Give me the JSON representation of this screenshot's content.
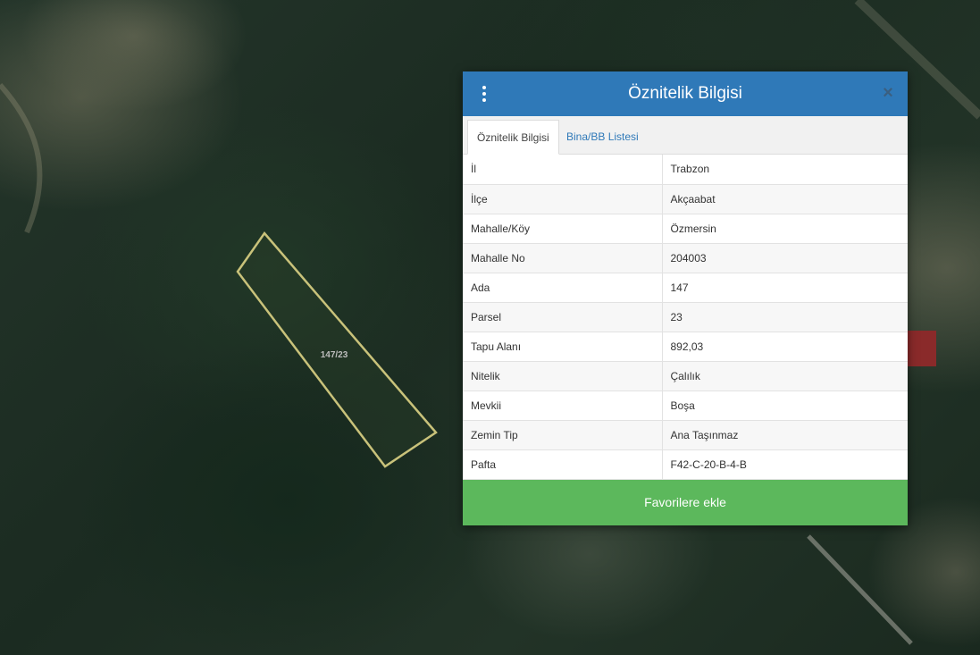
{
  "map": {
    "parcel_label": "147/23",
    "parcel_stroke": "#c9c27a"
  },
  "panel": {
    "title": "Öznitelik Bilgisi",
    "tabs": [
      {
        "label": "Öznitelik Bilgisi",
        "active": true
      },
      {
        "label": "Bina/BB Listesi",
        "active": false
      }
    ],
    "rows": [
      {
        "key": "İl",
        "value": "Trabzon"
      },
      {
        "key": "İlçe",
        "value": "Akçaabat"
      },
      {
        "key": "Mahalle/Köy",
        "value": "Özmersin"
      },
      {
        "key": "Mahalle No",
        "value": "204003"
      },
      {
        "key": "Ada",
        "value": "147"
      },
      {
        "key": "Parsel",
        "value": "23"
      },
      {
        "key": "Tapu Alanı",
        "value": "892,03"
      },
      {
        "key": "Nitelik",
        "value": "Çalılık"
      },
      {
        "key": "Mevkii",
        "value": "Boşa"
      },
      {
        "key": "Zemin Tip",
        "value": "Ana Taşınmaz"
      },
      {
        "key": "Pafta",
        "value": "F42-C-20-B-4-B"
      }
    ],
    "favorite_label": "Favorilere ekle",
    "header_color": "#2f79b8",
    "button_color": "#5cb85c"
  }
}
